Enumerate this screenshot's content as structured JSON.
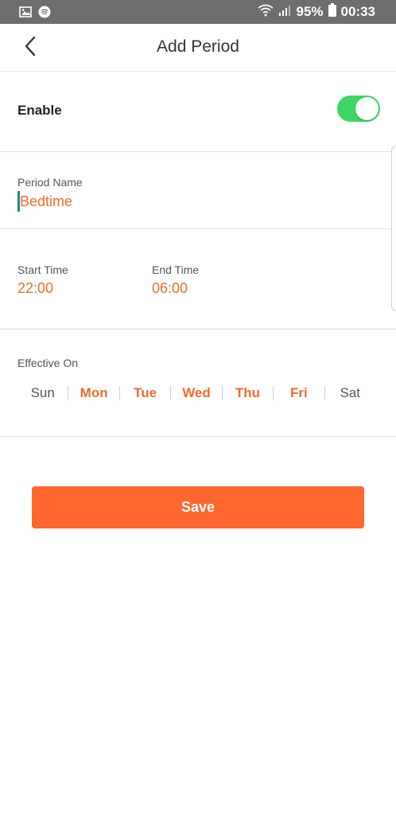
{
  "status_bar": {
    "battery": "95%",
    "time": "00:33",
    "icons": [
      "image-icon",
      "spotify-icon",
      "wifi-icon",
      "signal-icon",
      "battery-icon"
    ]
  },
  "header": {
    "title": "Add Period",
    "back_icon": "chevron-left-icon"
  },
  "enable": {
    "label": "Enable",
    "on": true,
    "toggle_color": "#3ed663"
  },
  "period_name": {
    "label": "Period Name",
    "value": "Bedtime"
  },
  "start_time": {
    "label": "Start Time",
    "value": "22:00"
  },
  "end_time": {
    "label": "End Time",
    "value": "06:00"
  },
  "effective_on": {
    "label": "Effective On",
    "days": [
      {
        "label": "Sun",
        "selected": false
      },
      {
        "label": "Mon",
        "selected": true
      },
      {
        "label": "Tue",
        "selected": true
      },
      {
        "label": "Wed",
        "selected": true
      },
      {
        "label": "Thu",
        "selected": true
      },
      {
        "label": "Fri",
        "selected": true
      },
      {
        "label": "Sat",
        "selected": false
      }
    ]
  },
  "save": {
    "label": "Save"
  },
  "colors": {
    "accent": "#f26a2e",
    "save_button": "#ff672f",
    "status_bar": "#6d6d6d"
  }
}
